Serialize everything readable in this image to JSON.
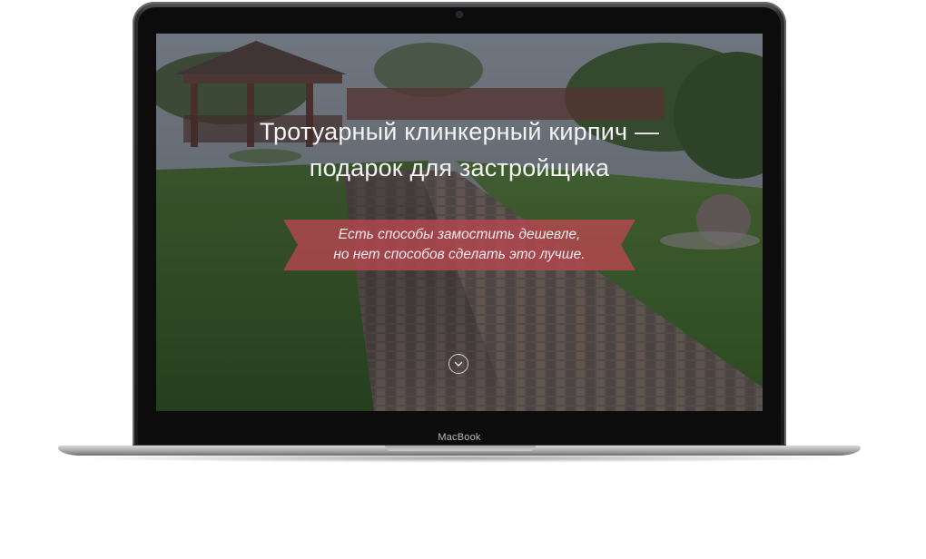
{
  "device": {
    "brand_label": "MacBook"
  },
  "hero": {
    "title_line1": "Тротуарный клинкерный кирпич —",
    "title_line2": "подарок для застройщика",
    "ribbon_line1": "Есть способы замостить дешевле,",
    "ribbon_line2": "но нет способов сделать это лучше.",
    "ribbon_color": "#b5474f",
    "scroll_icon": "chevron-down-icon"
  }
}
